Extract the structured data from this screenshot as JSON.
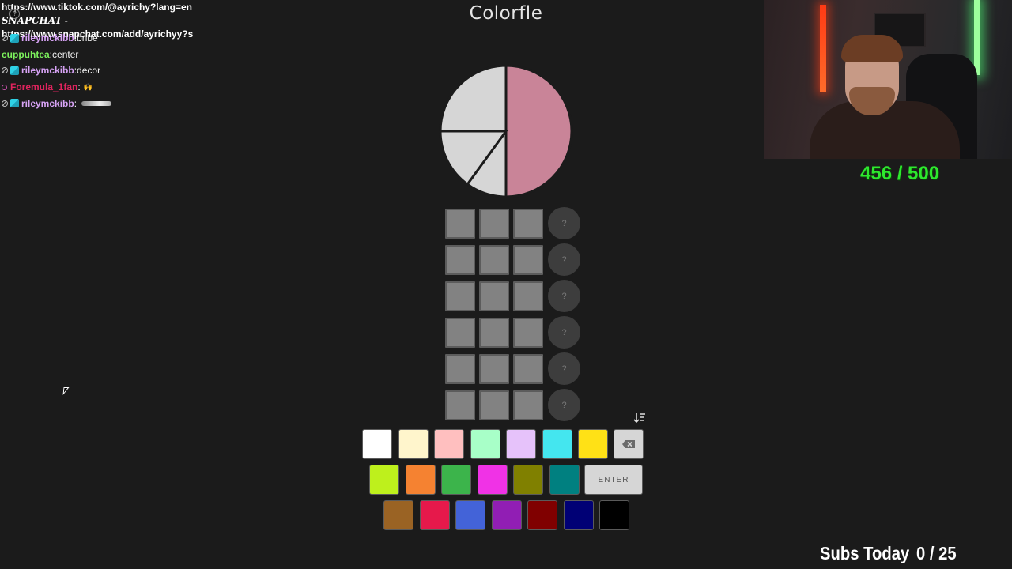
{
  "header": {
    "title": "Colorfle",
    "link_tiktok": "https://www.tiktok.com/@ayrichy?lang=en",
    "link_snap_label": "SNAPCHAT",
    "link_snap_dash": " -",
    "link_snapchat": "https://www.snapchat.com/add/ayrichyy?s",
    "help_icon": "?"
  },
  "chat": [
    {
      "user": "rileymckibb",
      "sep": " : ",
      "message": "bribe",
      "color": "#d7a3f5",
      "badges": [
        "mod",
        "sub"
      ]
    },
    {
      "user": "cuppuhtea",
      "sep": " : ",
      "message": "center",
      "color": "#7cf05c",
      "badges": []
    },
    {
      "user": "rileymckibb",
      "sep": " : ",
      "message": "decor",
      "color": "#d7a3f5",
      "badges": [
        "mod",
        "sub"
      ]
    },
    {
      "user": "Foremula_1fan",
      "sep": " : ",
      "message": "",
      "color": "#e0245e",
      "badges": [
        "pink"
      ],
      "emote": "hands-emote"
    },
    {
      "user": "rileymckibb",
      "sep": " : ",
      "message": "",
      "color": "#d7a3f5",
      "badges": [
        "mod",
        "sub"
      ],
      "emote": "airplane-emote"
    }
  ],
  "target_pie": {
    "slices": [
      {
        "name": "right-half",
        "color": "#c98498",
        "fraction": 0.5
      },
      {
        "name": "top-left-quarter",
        "color": "#d6d6d6",
        "fraction": 0.25
      },
      {
        "name": "lower-left-wedge",
        "color": "#d6d6d6",
        "fraction": 0.15
      },
      {
        "name": "bottom-wedge",
        "color": "#d6d6d6",
        "fraction": 0.1
      }
    ]
  },
  "grid": {
    "rows": 6,
    "cells_per_row": 3,
    "empty_cell_color": "#828282",
    "hint_label": "?"
  },
  "keyboard": {
    "row1": [
      "#ffffff",
      "#fff5cc",
      "#ffbfbf",
      "#a8ffc8",
      "#e6c2fa",
      "#44e6ef",
      "#ffe116"
    ],
    "row2": [
      "#bef01c",
      "#f58231",
      "#3cb44b",
      "#f032e6",
      "#808000",
      "#008080"
    ],
    "row3": [
      "#9a6324",
      "#e6194b",
      "#4363d8",
      "#911eb4",
      "#800000",
      "#000075",
      "#000000"
    ],
    "enter_label": "ENTER",
    "backspace_icon": "backspace-icon",
    "sort_icon": "sort-icon"
  },
  "overlay": {
    "progress": "456 / 500",
    "subs_label": "Subs Today",
    "subs_value": "0 / 25"
  }
}
